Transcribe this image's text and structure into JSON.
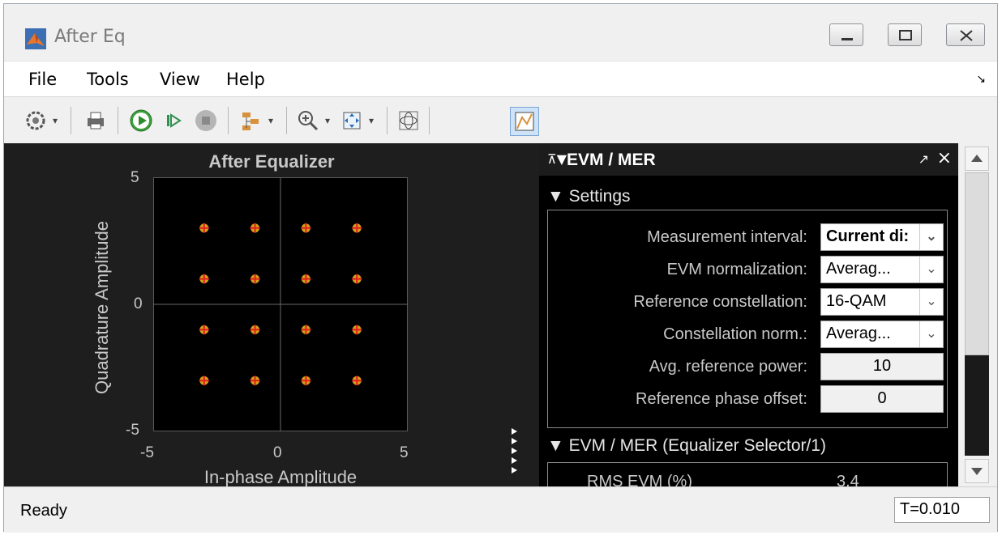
{
  "window": {
    "title": "After Eq",
    "buttons": [
      "minimize",
      "maximize",
      "close"
    ]
  },
  "menu": {
    "items": [
      "File",
      "Tools",
      "View",
      "Help"
    ]
  },
  "toolbar": {
    "icons": [
      "gear-icon",
      "print-icon",
      "run-icon",
      "step-forward-icon",
      "stop-icon",
      "signal-select-icon",
      "zoom-in-icon",
      "zoom-fit-icon",
      "constellation-icon",
      "measure-icon"
    ]
  },
  "chart_data": {
    "type": "scatter",
    "title": "After Equalizer",
    "xlabel": "In-phase Amplitude",
    "ylabel": "Quadrature Amplitude",
    "xlim": [
      -5,
      5
    ],
    "ylim": [
      -5,
      5
    ],
    "xticks": [
      "-5",
      "0",
      "5"
    ],
    "yticks": [
      "5",
      "0",
      "-5"
    ],
    "points": [
      {
        "x": -3,
        "y": 3
      },
      {
        "x": -1,
        "y": 3
      },
      {
        "x": 1,
        "y": 3
      },
      {
        "x": 3,
        "y": 3
      },
      {
        "x": -3,
        "y": 1
      },
      {
        "x": -1,
        "y": 1
      },
      {
        "x": 1,
        "y": 1
      },
      {
        "x": 3,
        "y": 1
      },
      {
        "x": -3,
        "y": -1
      },
      {
        "x": -1,
        "y": -1
      },
      {
        "x": 1,
        "y": -1
      },
      {
        "x": 3,
        "y": -1
      },
      {
        "x": -3,
        "y": -3
      },
      {
        "x": -1,
        "y": -3
      },
      {
        "x": 1,
        "y": -3
      },
      {
        "x": 3,
        "y": -3
      }
    ],
    "grid": true,
    "colors": {
      "point": "#d4a017",
      "reference": "#e02020",
      "background": "#000000"
    }
  },
  "panel": {
    "title": "EVM / MER",
    "settings_header": "Settings",
    "settings": [
      {
        "label": "Measurement interval:",
        "value": "Current di:",
        "type": "select"
      },
      {
        "label": "EVM normalization:",
        "value": "Averag...",
        "type": "select"
      },
      {
        "label": "Reference constellation:",
        "value": "16-QAM",
        "type": "select"
      },
      {
        "label": "Constellation norm.:",
        "value": "Averag...",
        "type": "select"
      },
      {
        "label": "Avg. reference power:",
        "value": "10",
        "type": "number"
      },
      {
        "label": "Reference phase offset:",
        "value": "0",
        "type": "number"
      }
    ],
    "results_header": "EVM / MER (Equalizer Selector/1)",
    "results": [
      {
        "label": "RMS EVM (%)",
        "value": "3.4"
      }
    ]
  },
  "status": {
    "text": "Ready",
    "time": "T=0.010"
  }
}
